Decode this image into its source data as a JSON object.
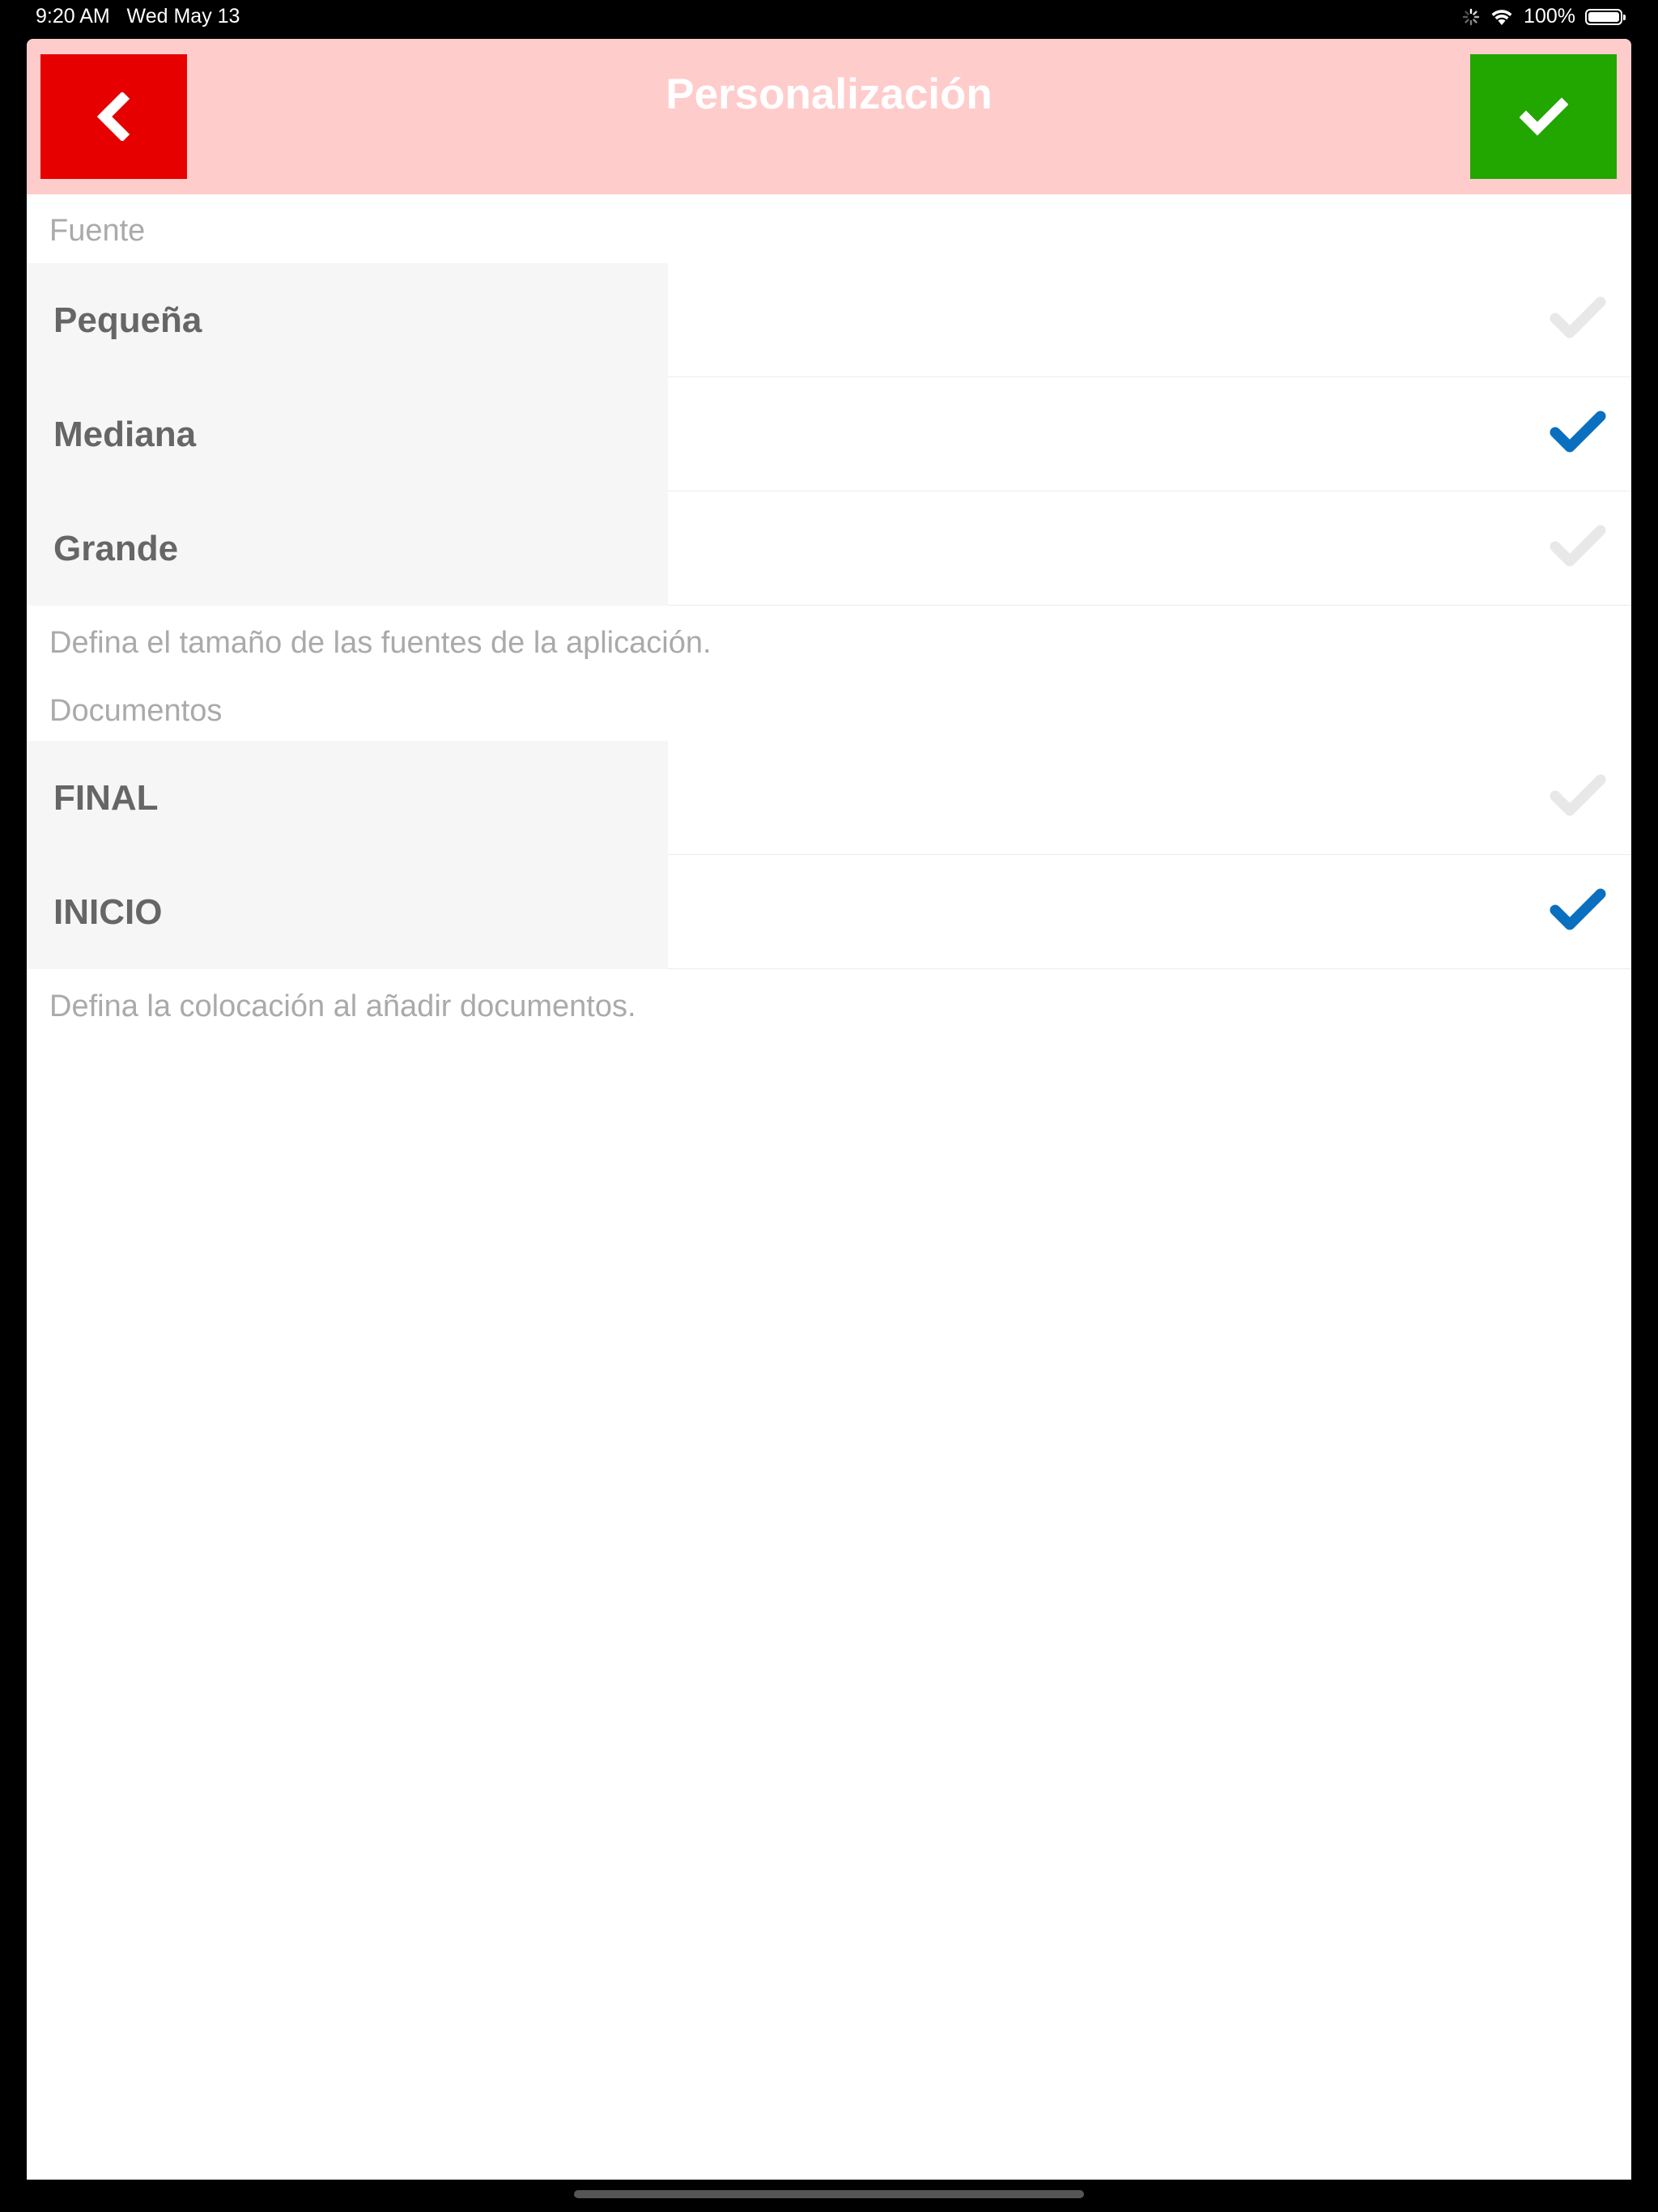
{
  "status_bar": {
    "time_date": "9:20 AM   Wed May 13",
    "battery": "100%"
  },
  "nav": {
    "title": "Personalización",
    "back_icon": "chevron-left-icon",
    "confirm_icon": "checkmark-icon",
    "colors": {
      "bar": "#ffcccc",
      "back": "#e60000",
      "confirm": "#22a600"
    }
  },
  "font_section": {
    "header": "Fuente",
    "options": [
      {
        "label": "Pequeña",
        "selected": false
      },
      {
        "label": "Mediana",
        "selected": true
      },
      {
        "label": "Grande",
        "selected": false
      }
    ],
    "footer": "Defina el tamaño de las fuentes de la aplicación."
  },
  "documents_section": {
    "header": "Documentos",
    "options": [
      {
        "label": "FINAL",
        "selected": false
      },
      {
        "label": "INICIO",
        "selected": true
      }
    ],
    "footer": "Defina la colocación al añadir documentos."
  },
  "check_colors": {
    "selected": "#0a6fbf",
    "unselected": "#e8e8e8"
  }
}
